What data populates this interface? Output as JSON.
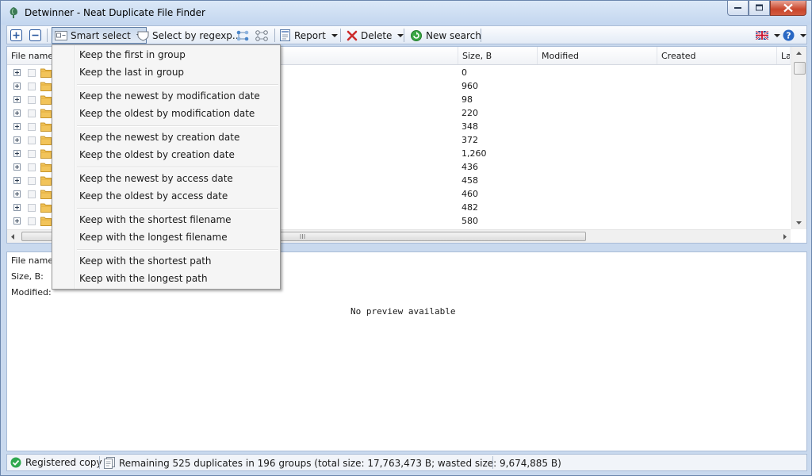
{
  "window": {
    "title": "Detwinner - Neat Duplicate File Finder",
    "icons": {
      "app": "tree-icon",
      "minimize": "minimize-icon",
      "maximize": "maximize-icon",
      "close": "close-icon"
    }
  },
  "toolbar": {
    "expand_icon": "plus-square-icon",
    "collapse_icon": "minus-square-icon",
    "smart_select_label": "Smart select",
    "select_regexp_label": "Select by regexp...",
    "report_label": "Report",
    "delete_label": "Delete",
    "new_search_label": "New search",
    "language_icon": "uk-flag-icon",
    "help_icon": "help-icon"
  },
  "grid": {
    "columns": [
      {
        "label": "File name"
      },
      {
        "label": "Size, B"
      },
      {
        "label": "Modified"
      },
      {
        "label": "Created"
      },
      {
        "label": "Las"
      }
    ],
    "rows": [
      {
        "size": "0"
      },
      {
        "size": "960"
      },
      {
        "size": "98"
      },
      {
        "size": "220"
      },
      {
        "size": "348"
      },
      {
        "size": "372"
      },
      {
        "size": "1,260"
      },
      {
        "size": "436"
      },
      {
        "size": "458"
      },
      {
        "size": "460"
      },
      {
        "size": "482"
      },
      {
        "size": "580"
      }
    ]
  },
  "details": {
    "file_name_label": "File name:",
    "size_label": "Size, B:",
    "modified_label": "Modified:",
    "preview_text": "No preview available"
  },
  "smart_select_menu": {
    "items": [
      "Keep the first in group",
      "Keep the last in group",
      "Keep the newest by modification date",
      "Keep the oldest by modification date",
      "Keep the newest by creation date",
      "Keep the oldest by creation date",
      "Keep the newest by access date",
      "Keep the oldest by access date",
      "Keep with the shortest filename",
      "Keep with the longest filename",
      "Keep with the shortest path",
      "Keep with the longest path"
    ]
  },
  "status": {
    "registration": "Registered copy",
    "summary": "Remaining 525 duplicates in 196 groups (total size: 17,763,473 B; wasted size: 9,674,885 B)",
    "colors": {
      "ok": "#2fa84f"
    }
  }
}
